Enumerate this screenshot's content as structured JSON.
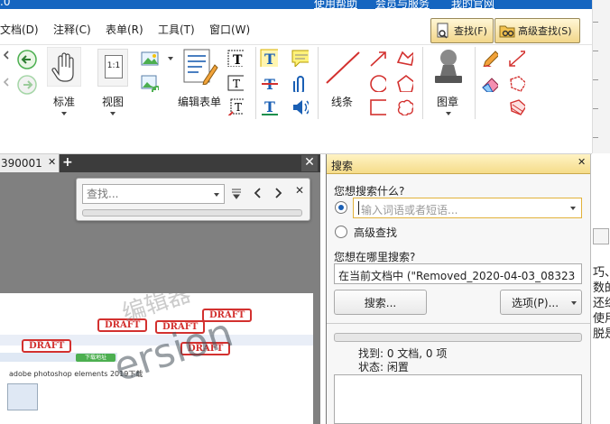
{
  "titlebar": {
    "help": "使用帮助",
    "service": "会员与服务",
    "official": "我的官网",
    "corner": ".0"
  },
  "menu": [
    "文档(D)",
    "注释(C)",
    "表单(R)",
    "工具(T)",
    "窗口(W)"
  ],
  "find_buttons": {
    "find": "查找(F)",
    "advanced": "高级查找(S)"
  },
  "ribbon": {
    "standard": "标准",
    "view": "视图",
    "edit_form": "编辑表单",
    "lines": "线条",
    "stamp": "图章",
    "view_icon": "1:1"
  },
  "document": {
    "tab_name": "390001",
    "find_placeholder": "查找...",
    "stamp_text": "DRAFT",
    "preview_site_title": "adobe photoshop elements 2019下载",
    "watermark_text": "ersion",
    "watermark_cn": "编辑器",
    "download_label": "下载地址"
  },
  "search_panel": {
    "title": "搜索",
    "question": "您想搜索什么?",
    "input_placeholder": "输入词语或者短语...",
    "advanced": "高级查找",
    "where": "您想在哪里搜索?",
    "scope": "在当前文档中 (\"Removed_2020-04-03_08323",
    "search_btn": "搜索...",
    "options_btn": "选项(P)...",
    "found": "找到: 0 文档, 0 项",
    "status": "状态: 闲置"
  },
  "right_edge": [
    "巧、",
    "数的",
    "还综",
    "使用",
    "脱是"
  ],
  "colors": {
    "titlebar": "#1565c0",
    "panel_header": "#f5dc8a",
    "stamp": "#d3312f",
    "accent": "#1a5fb4"
  }
}
